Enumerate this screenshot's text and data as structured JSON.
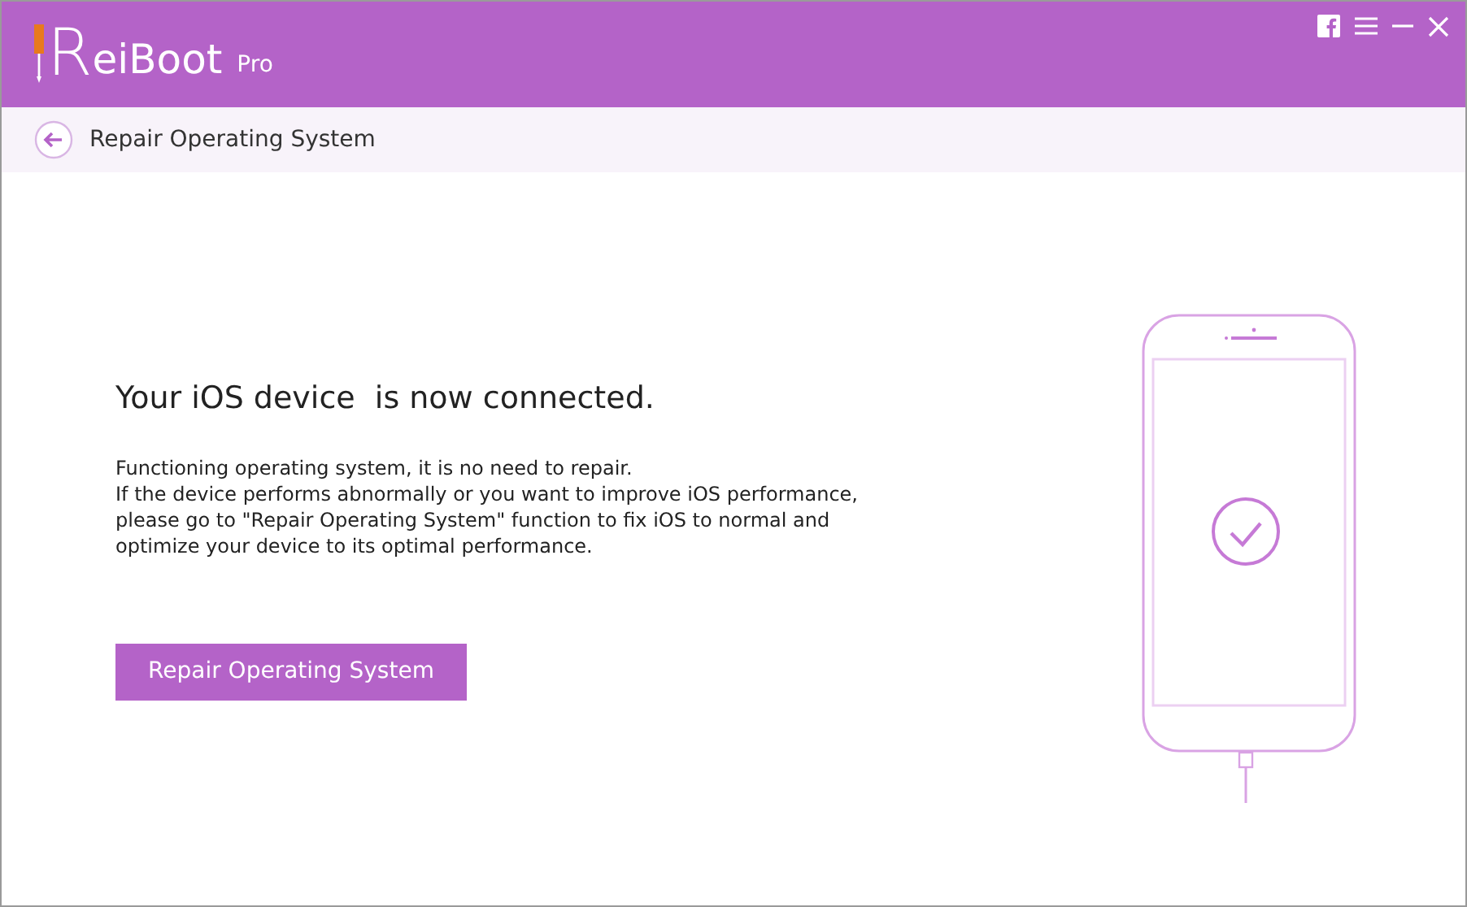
{
  "app": {
    "logo_initial": "R",
    "logo_name": "eiBoot",
    "edition": "Pro"
  },
  "page_header": {
    "title": "Repair Operating System"
  },
  "status": {
    "heading": "Your iOS device  is now connected.",
    "paragraphs": [
      "Functioning operating system, it is no need to repair.",
      "If the device performs abnormally or you want to improve iOS performance, please go to \"Repair Operating System\" function to fix iOS to normal and optimize your device to its optimal performance."
    ],
    "button": "Repair Operating System"
  }
}
